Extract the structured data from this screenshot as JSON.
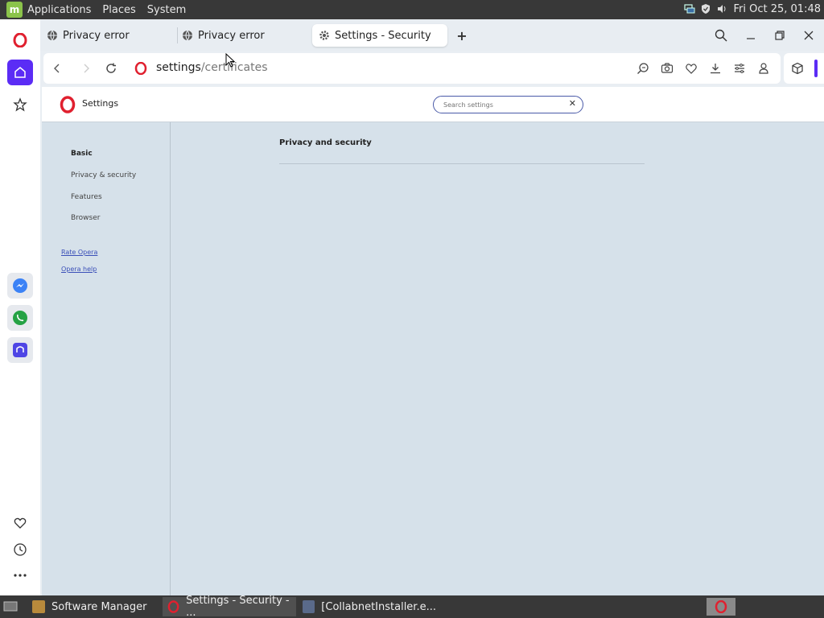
{
  "system_panel": {
    "menus": [
      "Applications",
      "Places",
      "System"
    ],
    "clock": "Fri Oct 25, 01:48"
  },
  "tabs": [
    {
      "label": "Privacy error",
      "icon": "globe-icon",
      "active": false
    },
    {
      "label": "Privacy error",
      "icon": "globe-icon",
      "active": false
    },
    {
      "label": "Settings - Security",
      "icon": "gear-icon",
      "active": true
    }
  ],
  "address": {
    "host": "settings",
    "path": "/certificates"
  },
  "settings": {
    "title": "Settings",
    "search_placeholder": "Search settings",
    "nav": [
      "Basic",
      "Privacy & security",
      "Features",
      "Browser"
    ],
    "links": [
      "Rate Opera",
      "Opera help"
    ],
    "section_title": "Privacy and security"
  },
  "taskbar": {
    "items": [
      "Software Manager",
      "Settings - Security - ...",
      "[CollabnetInstaller.e..."
    ]
  },
  "colors": {
    "accent": "#5b2cf5",
    "opera_red": "#e0202f",
    "page_bg": "#d6e1ea"
  }
}
